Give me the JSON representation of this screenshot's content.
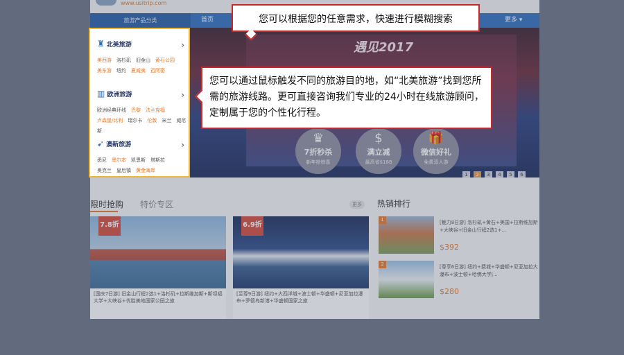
{
  "header": {
    "site_url": "www.usitrip.com"
  },
  "navbar": {
    "category_label": "旅游产品分类",
    "items": [
      "首页",
      "更多 ▾"
    ]
  },
  "side_menu": {
    "categories": [
      {
        "name": "北美旅游",
        "icon": "statue-of-liberty-icon",
        "links": [
          "美西游",
          "洛杉矶",
          "旧金山",
          "黄石公园",
          "美东游",
          "纽约",
          "夏威夷",
          "迈阿密"
        ]
      },
      {
        "name": "欧洲旅游",
        "icon": "building-icon",
        "links": [
          "欧洲经典环线",
          "巴黎",
          "法兰克福",
          "卢森堡/比利",
          "瑞尔卡",
          "伦敦",
          "米兰",
          "威尼斯"
        ]
      },
      {
        "name": "澳新旅游",
        "icon": "kangaroo-icon",
        "links": [
          "悉尼",
          "墨尔本",
          "凯恩斯",
          "塔斯拉",
          "奥克兰",
          "皇后镇",
          "黄金海岸"
        ]
      }
    ]
  },
  "hero": {
    "title": "遇见2017",
    "promos": [
      {
        "icon": "crown-icon",
        "title": "7折秒杀",
        "sub": "新年抢惊喜"
      },
      {
        "icon": "dollar-icon",
        "title": "满立减",
        "sub": "最高省$188"
      },
      {
        "icon": "gift-icon",
        "title": "微信好礼",
        "sub": "免费双人游"
      }
    ],
    "slides": [
      "1",
      "2",
      "3",
      "4",
      "5",
      "6"
    ],
    "active_slide": "2"
  },
  "lower": {
    "tabs": [
      "限时抢购",
      "特价专区"
    ],
    "more_label": "更多",
    "hot_title": "热销排行",
    "deals": [
      {
        "badge": "7.8折",
        "text": "[国庆7日游] 旧金山行程2选1+洛杉矶+拉斯维加斯+斯坦福大学+大峡谷+优胜美地国家公园之旅"
      },
      {
        "badge": "6.9折",
        "text": "[至尊9日游] 纽约+大西洋城+波士顿+华盛顿+尼亚加拉瀑布+罗德岛新港+华盛顿国家之旅"
      }
    ],
    "hot": [
      {
        "rank": "1",
        "text": "[魅力8日游] 洛杉矶+黄石+美国+拉斯维加斯+大峡谷+旧金山行程2选1+...",
        "price": "$392"
      },
      {
        "rank": "2",
        "text": "[尊享6日游] 纽约+费城+华盛顿+尼亚加拉大瀑布+波士顿+哈佛大学|...",
        "price": "$280"
      }
    ]
  },
  "tooltips": {
    "search": "您可以根据您的任意需求，快速进行模糊搜索",
    "menu": "您可以通过鼠标触发不同的旅游目的地，如“北美旅游”找到您所需的旅游线路。更可直接咨询我们专业的24小时在线旅游顾问，定制属于您的个性化行程。"
  }
}
